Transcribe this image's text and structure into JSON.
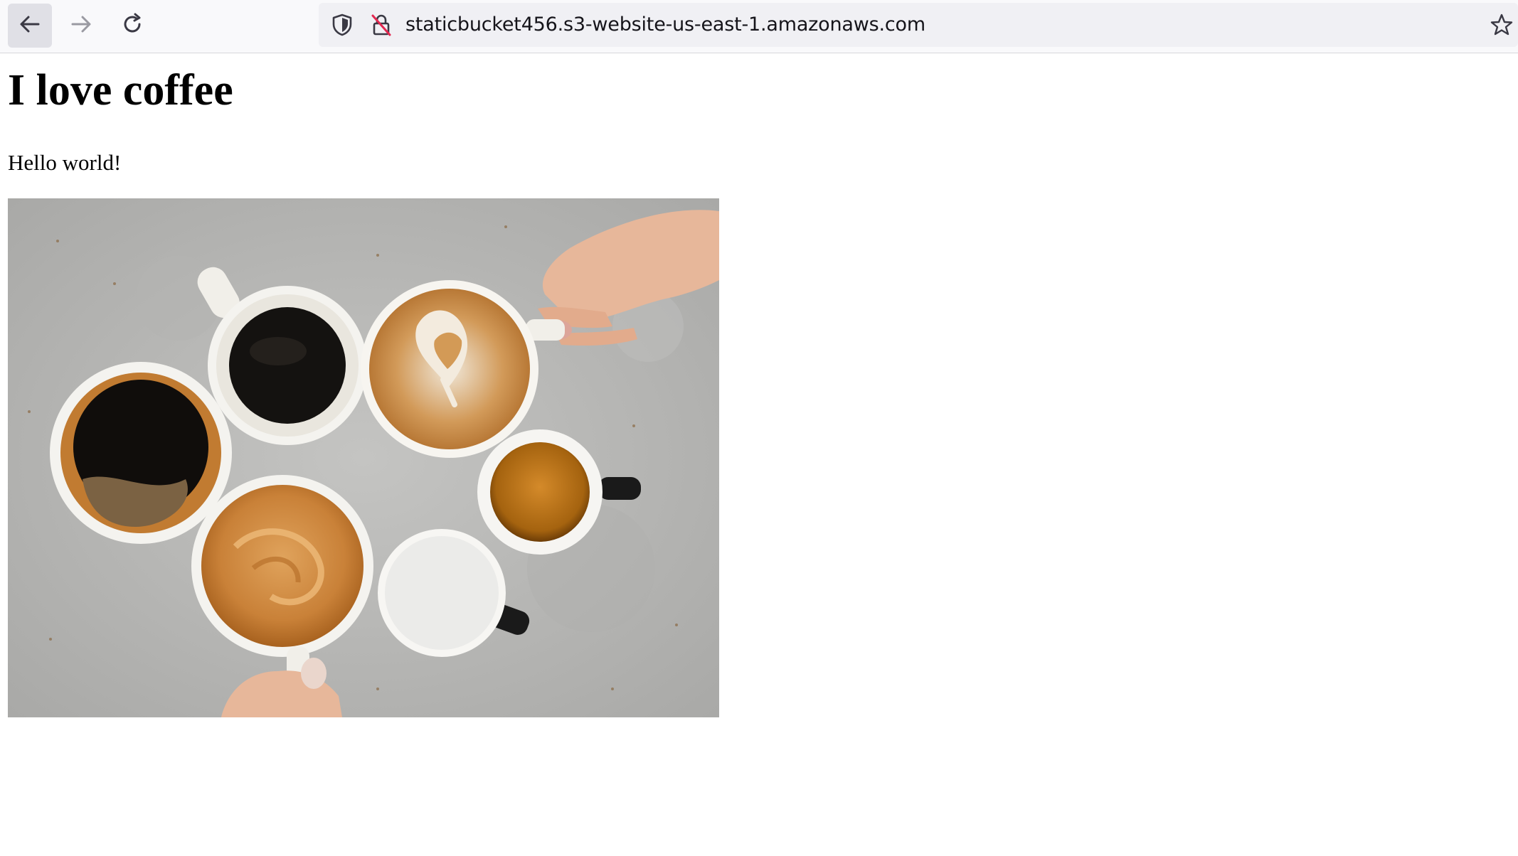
{
  "browser": {
    "url": "staticbucket456.s3-website-us-east-1.amazonaws.com",
    "icons": {
      "back": "back-arrow-icon",
      "forward": "forward-arrow-icon",
      "reload": "reload-icon",
      "tracking": "shield-icon",
      "security": "insecure-lock-icon",
      "bookmark": "star-icon"
    }
  },
  "page": {
    "heading": "I love coffee",
    "paragraph": "Hello world!"
  },
  "colors": {
    "toolbar_bg": "#f9f9fb",
    "urlbar_bg": "#f0f0f4",
    "insecure_accent": "#e22850",
    "photo_background": "#b9b9b7"
  }
}
